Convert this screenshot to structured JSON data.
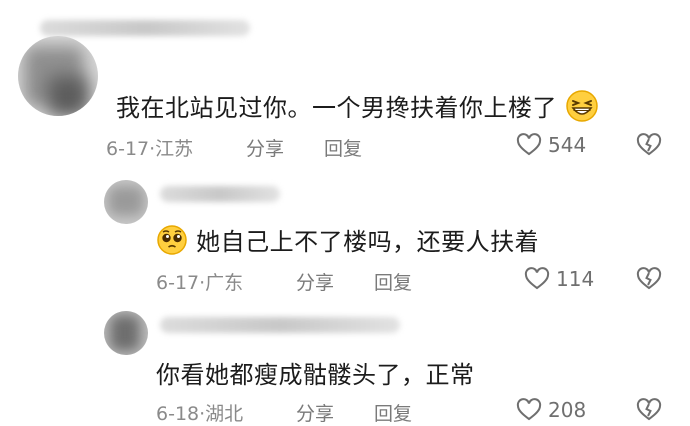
{
  "comments": [
    {
      "text": "我在北站见过你。一个男搀扶着你上楼了",
      "emoji": "grinning-squint-emoji",
      "date": "6-17",
      "location": "江苏",
      "share_label": "分享",
      "reply_label": "回复",
      "likes": "544"
    },
    {
      "text": "她自己上不了楼吗，还要人扶着",
      "emoji": "pleading-face-emoji",
      "date": "6-17",
      "location": "广东",
      "share_label": "分享",
      "reply_label": "回复",
      "likes": "114"
    },
    {
      "text": "你看她都瘦成骷髅头了，正常",
      "date": "6-18",
      "location": "湖北",
      "share_label": "分享",
      "reply_label": "回复",
      "likes": "208"
    }
  ],
  "separator": "·",
  "icons": {
    "like": "heart-outline-icon",
    "dislike": "broken-heart-icon"
  },
  "colors": {
    "text": "#1c1c1c",
    "meta": "#8a8a8a",
    "background": "#ffffff"
  }
}
